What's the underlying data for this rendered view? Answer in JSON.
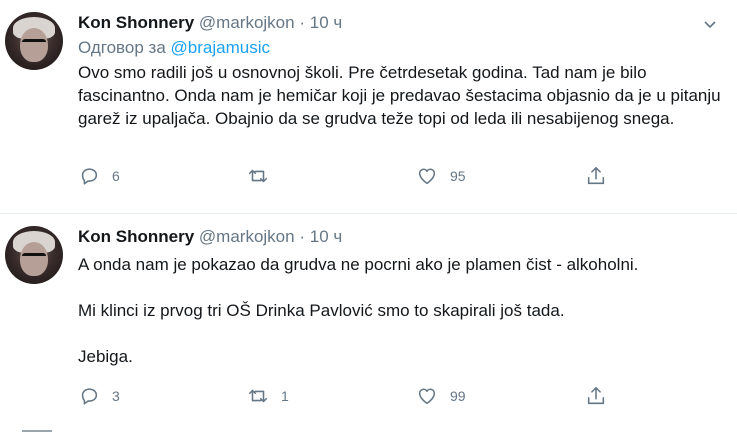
{
  "tweets": [
    {
      "author": {
        "name": "Kon Shonnery",
        "handle": "@markojkon"
      },
      "dot": "·",
      "time": "10 ч",
      "reply": {
        "prefix": "Одговор за",
        "mention": "@brajamusic"
      },
      "text": "Ovo smo radili još u osnovnoj školi. Pre četrdesetak godina. Tad nam je bilo fascinantno. Onda nam je hemičar koji je predavao šestacima objasnio da je u pitanju garež iz upaljača. Obajnio da se grudva teže topi od leda ili nesabijenog snega.",
      "actions": {
        "reply_count": "6",
        "retweet_count": "",
        "like_count": "95"
      }
    },
    {
      "author": {
        "name": "Kon Shonnery",
        "handle": "@markojkon"
      },
      "dot": "·",
      "time": "10 ч",
      "paragraphs": [
        "A onda nam je pokazao da grudva ne pocrni ako je plamen čist - alkoholni.",
        "Mi klinci iz prvog tri OŠ Drinka Pavlović smo to skapirali još tada.",
        "Jebiga."
      ],
      "actions": {
        "reply_count": "3",
        "retweet_count": "1",
        "like_count": "99"
      }
    }
  ],
  "colors": {
    "text": "#14171a",
    "muted": "#657786",
    "link": "#1da1f2",
    "divider": "#e6ecf0"
  },
  "icons": [
    "chevron-down-icon",
    "reply-icon",
    "retweet-icon",
    "like-icon",
    "share-icon"
  ]
}
